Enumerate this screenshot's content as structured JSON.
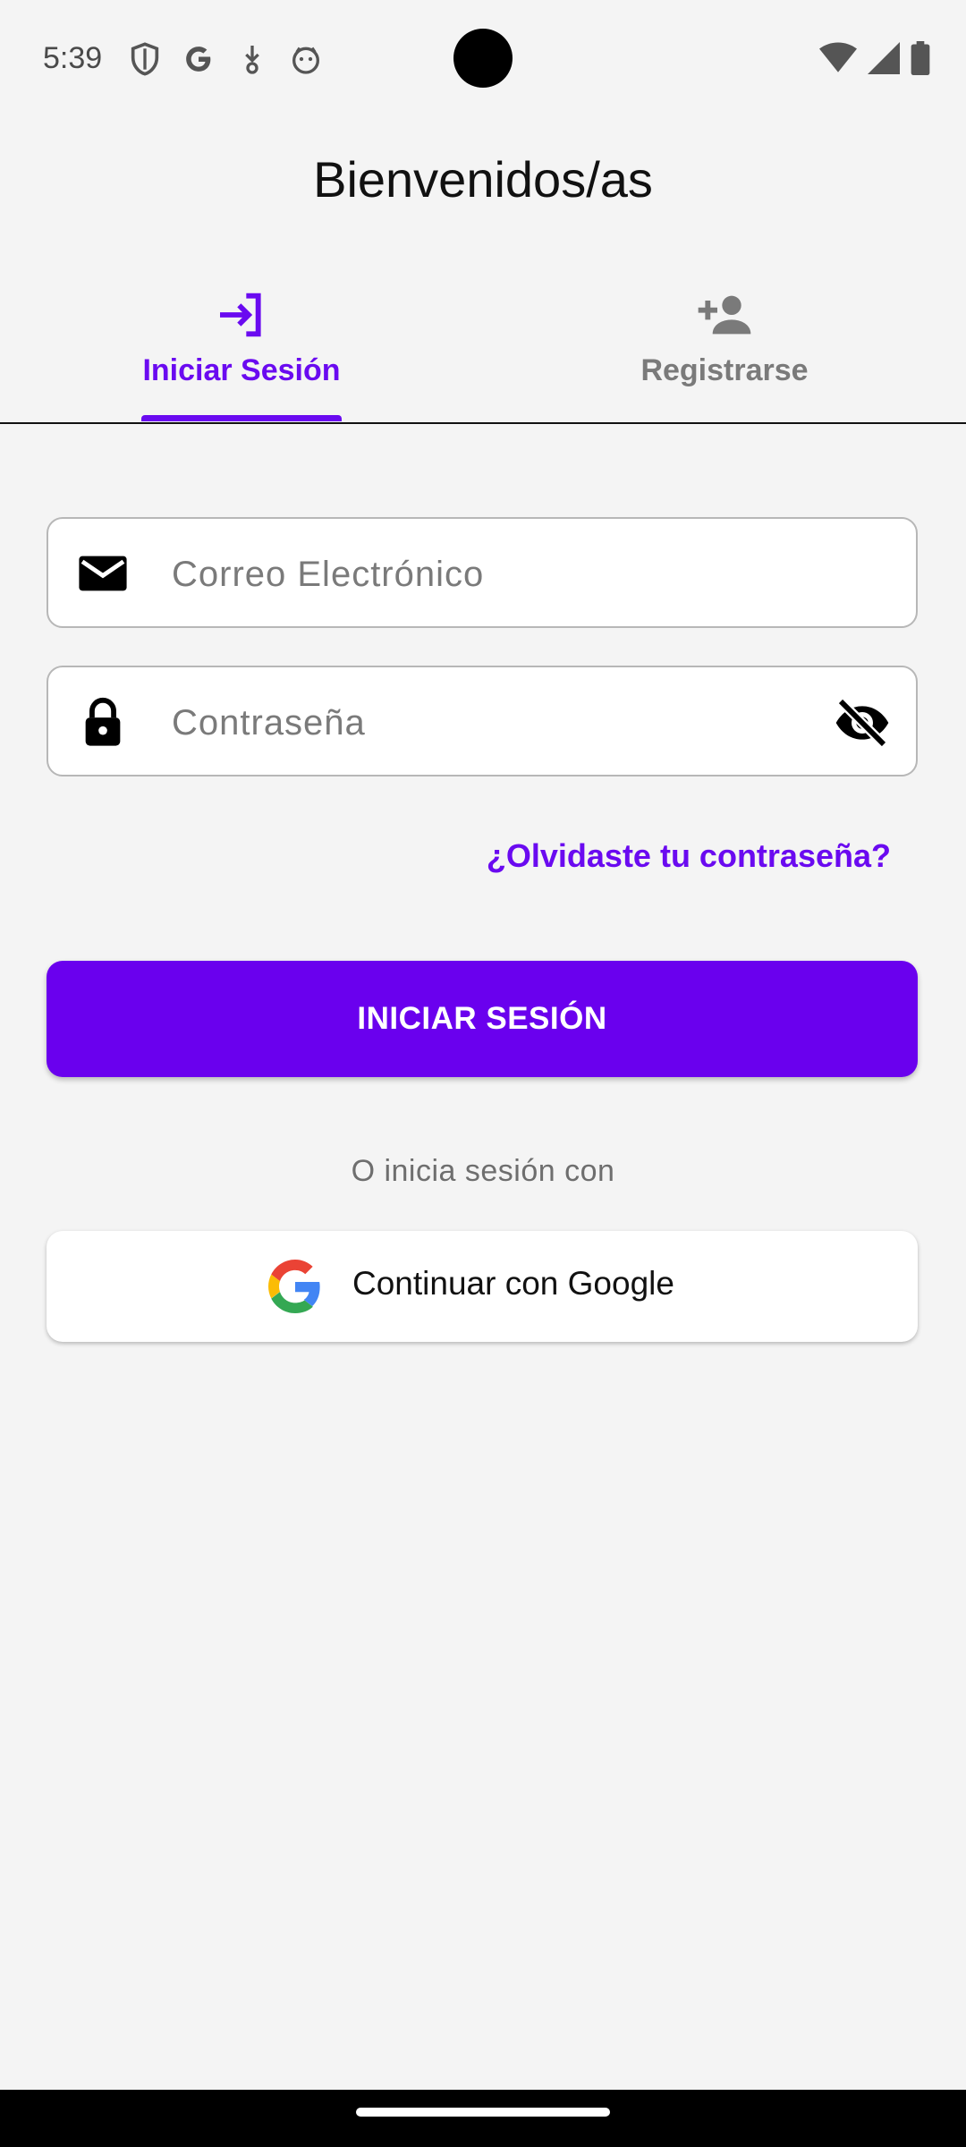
{
  "status_bar": {
    "time": "5:39",
    "left_icons": [
      "shield-icon",
      "google-g-icon",
      "download-arrow-icon",
      "cat-face-icon"
    ],
    "right_icons": [
      "wifi-icon",
      "cell-signal-icon",
      "battery-icon"
    ]
  },
  "header": {
    "title": "Bienvenidos/as"
  },
  "tabs": [
    {
      "label": "Iniciar Sesión",
      "icon": "login-icon",
      "active": true
    },
    {
      "label": "Registrarse",
      "icon": "person-add-icon",
      "active": false
    }
  ],
  "form": {
    "email": {
      "placeholder": "Correo Electrónico",
      "value": "",
      "icon": "mail-icon"
    },
    "password": {
      "placeholder": "Contraseña",
      "value": "",
      "icon": "lock-icon",
      "toggle_icon": "visibility-off-icon"
    },
    "forgot_label": "¿Olvidaste tu contraseña?",
    "submit_label": "INICIAR SESIÓN"
  },
  "alternative": {
    "caption": "O inicia sesión con",
    "google_label": "Continuar con Google"
  },
  "colors": {
    "accent": "#6a00ee",
    "background": "#f4f4f4",
    "inactive": "#7a7a7a"
  }
}
